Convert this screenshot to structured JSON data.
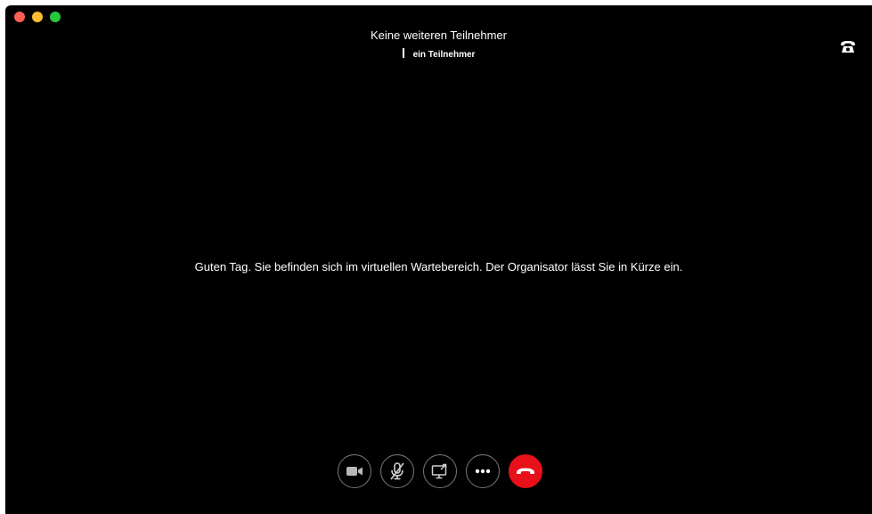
{
  "meeting": {
    "title": "Keine weiteren Teilnehmer",
    "participants": "ein Teilnehmer",
    "lobby_message": "Guten Tag. Sie befinden sich im virtuellen Wartebereich. Der Organisator lässt Sie in Kürze ein."
  },
  "window_controls": {
    "close_color": "#fe5f57",
    "minimize_color": "#febc2e",
    "maximize_color": "#28c840"
  },
  "toolbar": {
    "buttons": [
      {
        "icon": "video-camera-icon"
      },
      {
        "icon": "microphone-muted-icon"
      },
      {
        "icon": "share-screen-icon"
      },
      {
        "icon": "more-options-icon"
      },
      {
        "icon": "hang-up-icon",
        "color": "#e8101a"
      }
    ]
  },
  "header": {
    "audio_icon": "phone-icon"
  }
}
